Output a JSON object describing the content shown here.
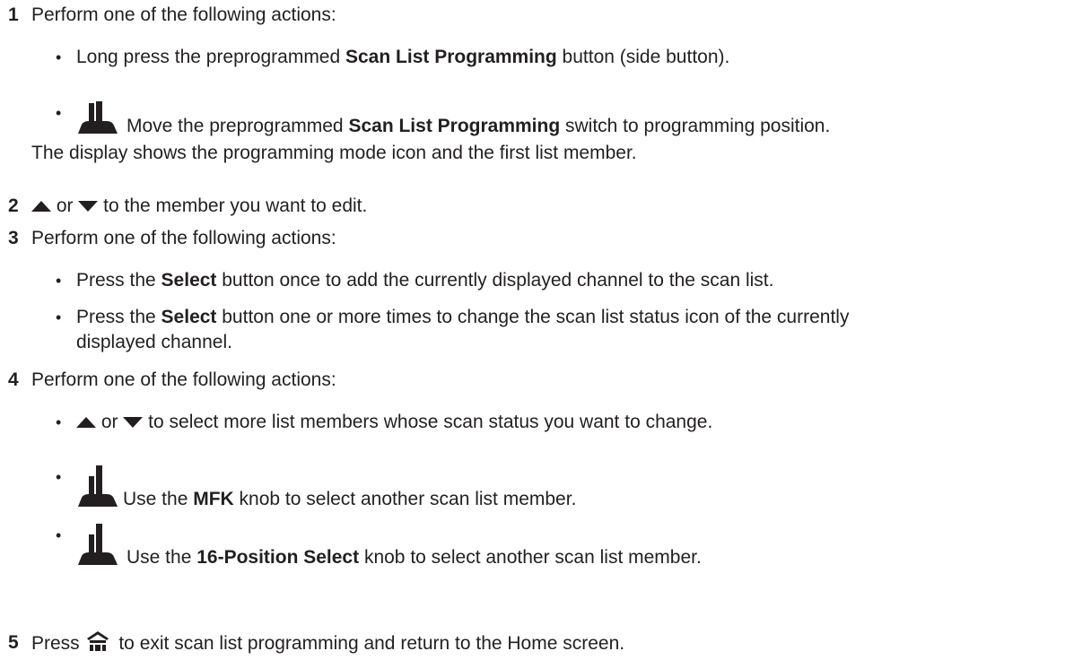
{
  "steps": [
    {
      "num": "1",
      "text": "Perform one of the following actions:",
      "bullets": [
        {
          "pre": "Long press the preprogrammed ",
          "bold": "Scan List Programming",
          "post": " button (side button)."
        },
        {
          "pre": "Move the preprogrammed ",
          "bold": "Scan List Programming",
          "post": " switch to programming position."
        }
      ],
      "note": "The display shows the programming mode icon and the first list member."
    },
    {
      "num": "2",
      "mid": " or ",
      "post": " to the member you want to edit."
    },
    {
      "num": "3",
      "text": "Perform one of the following actions:",
      "bullets": [
        {
          "pre": "Press the ",
          "bold": "Select",
          "post": " button once to add the currently displayed channel to the scan list."
        },
        {
          "pre": "Press the ",
          "bold": "Select",
          "post": " button one or more times to change the scan list status icon of the currently",
          "post2": "displayed channel."
        }
      ]
    },
    {
      "num": "4",
      "text": "Perform one of the following actions:",
      "bullets": [
        {
          "mid": " or ",
          "post": " to select more list members whose scan status you want to change."
        },
        {
          "pre": "Use the ",
          "bold": "MFK",
          "post": " knob to select another scan list member."
        },
        {
          "pre": "Use the ",
          "bold": "16-Position Select",
          "post": " knob to select another scan list member."
        }
      ]
    },
    {
      "num": "5",
      "pre": "Press ",
      "post": " to exit scan list programming and return to the Home screen."
    }
  ],
  "bullet_char": "•",
  "icons": [
    "radio-model-icon",
    "up-arrow-icon",
    "down-arrow-icon",
    "home-icon"
  ]
}
